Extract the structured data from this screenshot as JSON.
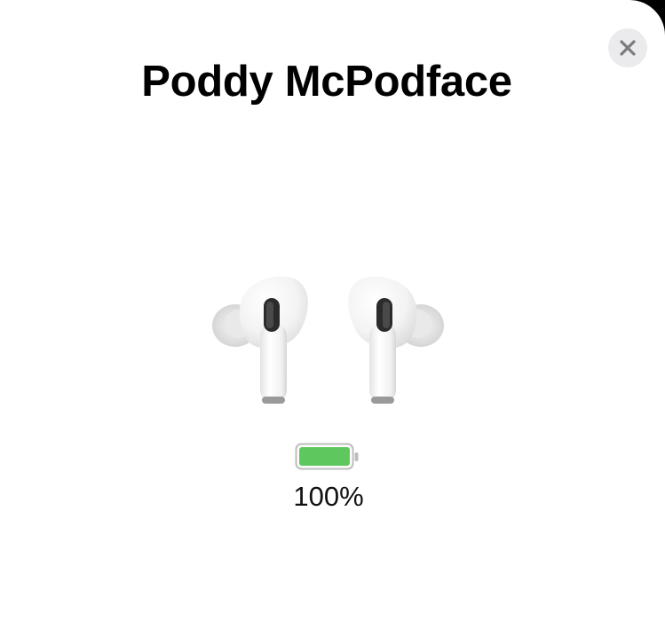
{
  "device": {
    "name": "Poddy McPodface",
    "image_icon": "airpods-pro-icon",
    "battery_icon": "battery-icon",
    "battery_fraction": 1.0,
    "battery_label": "100%"
  },
  "close_button": {
    "icon": "close-icon"
  },
  "colors": {
    "background": "#ffffff",
    "battery_fill": "#5ec85e",
    "close_button_bg": "#ebebed",
    "close_glyph": "#7b7b80"
  }
}
